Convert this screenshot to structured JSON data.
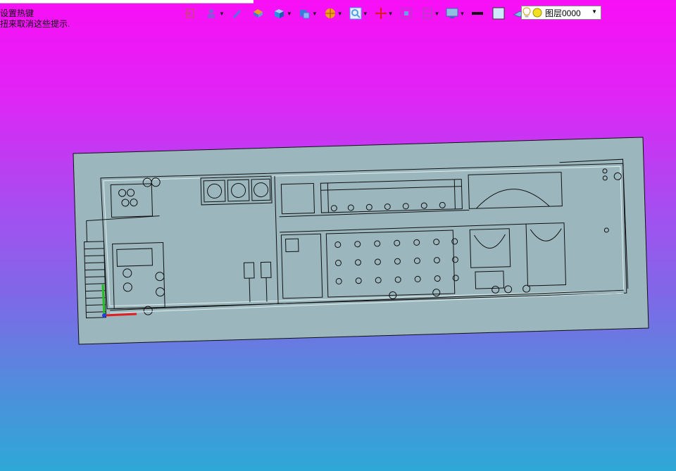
{
  "hints": {
    "line1": "设置热键",
    "line2": "扭来取消这些提示."
  },
  "toolbar": {
    "items": [
      {
        "name": "view-exit-icon",
        "color": "#d23c8c",
        "dropdown": false
      },
      {
        "name": "visibility-icon",
        "color": "#6b6bd0",
        "dropdown": true
      },
      {
        "name": "pen-icon",
        "color": "#4a78e0",
        "dropdown": false
      },
      {
        "name": "shaded-box-icon",
        "color": "#e8a020",
        "dropdown": false
      },
      {
        "name": "cube-icon",
        "color": "#2a90e0",
        "dropdown": true
      },
      {
        "name": "view-cube-icon",
        "color": "#3a7ad8",
        "dropdown": true
      },
      {
        "name": "render-ball-icon",
        "color": "#f0a020",
        "dropdown": true
      },
      {
        "name": "zoom-icon",
        "color": "#4aa0e8",
        "dropdown": true
      },
      {
        "name": "pan-icon",
        "color": "#d82020",
        "dropdown": true
      },
      {
        "name": "fit-view-icon",
        "color": "#b040c0",
        "dropdown": false
      },
      {
        "name": "section-icon",
        "color": "#b040c0",
        "dropdown": true
      },
      {
        "name": "monitor-icon",
        "color": "#3a6ab0",
        "dropdown": true
      },
      {
        "name": "line-weight-icon",
        "color": "#111111",
        "dropdown": false
      },
      {
        "name": "color-swatch-icon",
        "color": "#cfe8ff",
        "dropdown": false
      },
      {
        "name": "layer-plane-icon",
        "color": "#7ac0e0",
        "dropdown": true
      }
    ]
  },
  "layer": {
    "current": "图层0000"
  },
  "colors": {
    "drawing_fill": "#9bb6bd",
    "line": "#111111",
    "axis_x": "#e02020",
    "axis_y": "#20c020"
  }
}
